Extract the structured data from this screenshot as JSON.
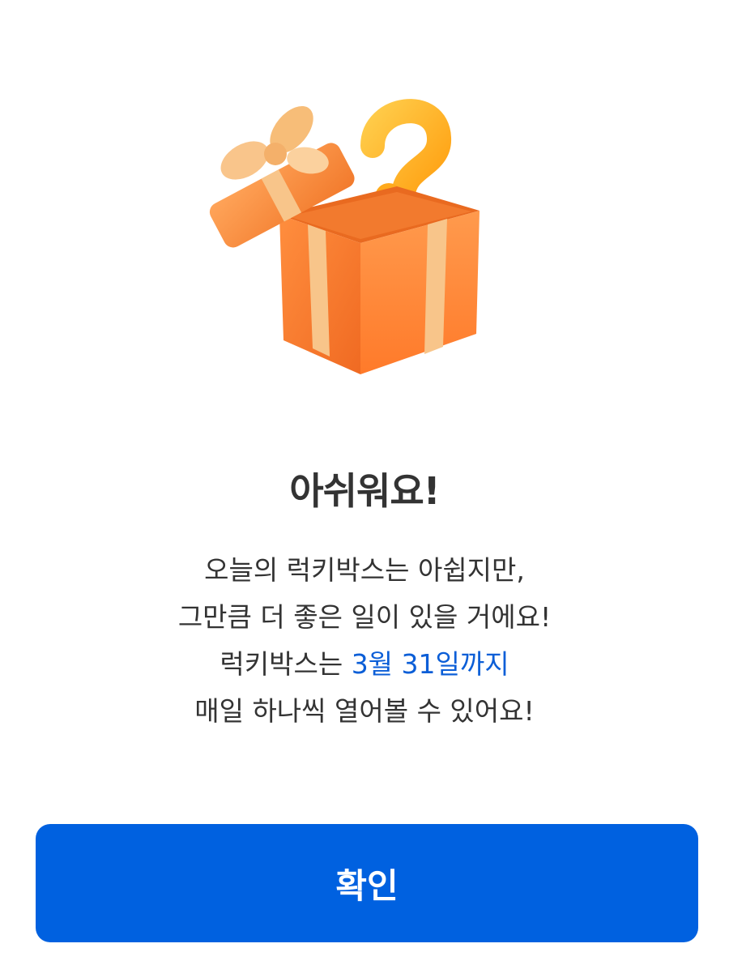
{
  "dialog": {
    "illustration_icon": "open-gift-box-question-mark-icon",
    "title": "아쉬워요!",
    "message": {
      "line1": "오늘의 럭키박스는 아쉽지만,",
      "line2": "그만큼 더 좋은 일이 있을 거에요!",
      "line3_prefix": "럭키박스는 ",
      "line3_highlight": "3월 31일까지",
      "line4": "매일 하나씩 열어볼 수 있어요!"
    },
    "confirm_label": "확인"
  },
  "colors": {
    "primary_button": "#0061e0",
    "highlight_text": "#0b5ed7",
    "box_orange": "#ff8a3d",
    "ribbon": "#f8c58a",
    "question_mark": "#ffb21e"
  }
}
